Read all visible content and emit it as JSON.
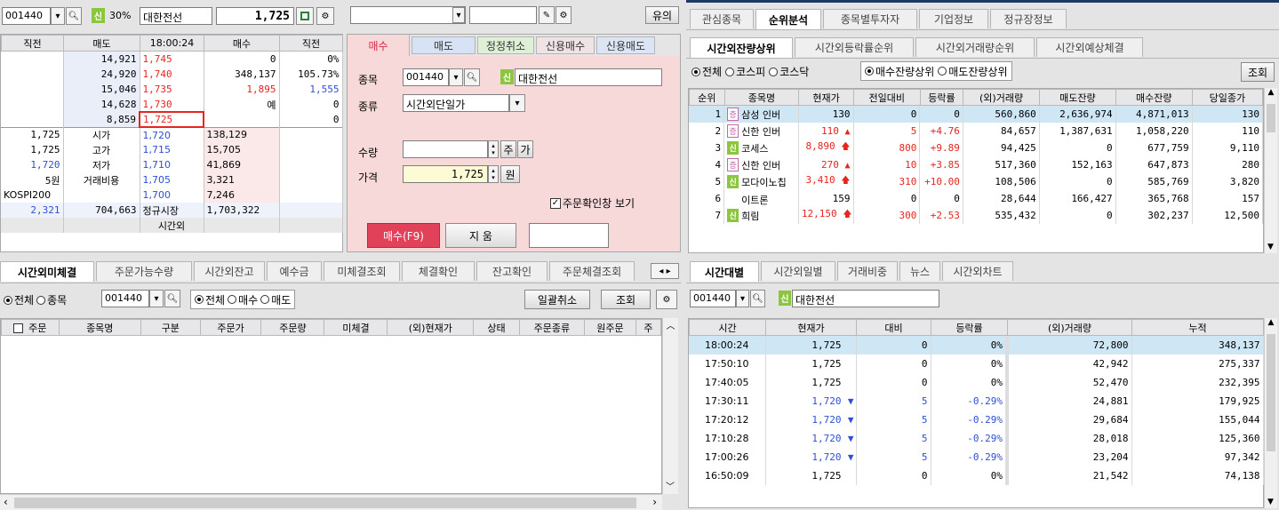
{
  "quote": {
    "code": "001440",
    "sin": "신",
    "ratio": "30%",
    "name": "대한전선",
    "price": "1,725",
    "warn_btn": "유의"
  },
  "orderbook": {
    "headers": [
      "직전",
      "매도",
      "18:00:24",
      "매수",
      "직전"
    ],
    "asks": [
      {
        "qty": "14,921",
        "price": "1,745",
        "pct": "0%"
      },
      {
        "qty": "24,920",
        "price": "1,740",
        "pct": "105.73%"
      },
      {
        "qty": "15,046",
        "price": "1,735",
        "pct": ""
      },
      {
        "qty": "14,628",
        "price": "1,730",
        "pct": ""
      },
      {
        "qty": "8,859",
        "price": "1,725",
        "pct": "0%"
      }
    ],
    "ask_side_extra": [
      {
        "a": "0",
        "b": ""
      },
      {
        "a": "348,137",
        "b": ""
      },
      {
        "a": "1,895",
        "b": "1,555"
      },
      {
        "a": "예",
        "b": "0"
      },
      {
        "a": "",
        "b": "0"
      }
    ],
    "bids": [
      {
        "label_v": "1,725",
        "label": "시가",
        "price": "1,720",
        "qty": "138,129"
      },
      {
        "label_v": "1,725",
        "label": "고가",
        "price": "1,715",
        "qty": "15,705"
      },
      {
        "label_v": "1,720",
        "label": "저가",
        "price": "1,710",
        "qty": "41,869"
      },
      {
        "label_v": "5원",
        "label": "거래비용",
        "price": "1,705",
        "qty": "3,321"
      },
      {
        "label_v": "KOSPI200",
        "label": "",
        "price": "1,700",
        "qty": "7,246"
      }
    ],
    "total": {
      "left": "2,321",
      "ask_total": "704,663",
      "mid": "정규시장",
      "bid_total": "1,703,322"
    },
    "footer": "시간외"
  },
  "order_panel": {
    "tabs": [
      "매수",
      "매도",
      "정정취소",
      "신용매수",
      "신용매도"
    ],
    "code_label": "종목",
    "code": "001440",
    "sin": "신",
    "name": "대한전선",
    "type_label": "종류",
    "type_value": "시간외단일가",
    "qty_label": "수량",
    "qty_btn1": "주",
    "qty_btn2": "가",
    "price_label": "가격",
    "price_value": "1,725",
    "price_unit": "원",
    "confirm_check": "주문확인창 보기",
    "buy_button": "매수(F9)",
    "clear_button": "지 움"
  },
  "ranking": {
    "top_tabs": [
      "관심종목",
      "순위분석",
      "종목별투자자",
      "기업정보",
      "정규장정보"
    ],
    "sub_tabs": [
      "시간외잔량상위",
      "시간외등락률순위",
      "시간외거래량순위",
      "시간외예상체결"
    ],
    "filters": [
      "전체",
      "코스피",
      "코스닥"
    ],
    "modes": [
      "매수잔량상위",
      "매도잔량상위"
    ],
    "query_button": "조회",
    "columns": [
      "순위",
      "종목명",
      "현재가",
      "전일대비",
      "등락률",
      "(외)거래량",
      "매도잔량",
      "매수잔량",
      "당일종가"
    ],
    "rows": [
      {
        "rank": "1",
        "badge": "jeung",
        "name": "삼성 인버",
        "price": "130",
        "chg": "0",
        "arrow": "",
        "rate": "0",
        "vol": "560,860",
        "ask": "2,636,974",
        "bid": "4,871,013",
        "close": "130",
        "color": ""
      },
      {
        "rank": "2",
        "badge": "jeung",
        "name": "신한 인버",
        "price": "110",
        "chg": "5",
        "arrow": "▲",
        "rate": "+4.76",
        "vol": "84,657",
        "ask": "1,387,631",
        "bid": "1,058,220",
        "close": "110",
        "color": "red"
      },
      {
        "rank": "3",
        "badge": "sin",
        "name": "코세스",
        "price": "8,890",
        "chg": "800",
        "arrow": "🡅",
        "rate": "+9.89",
        "vol": "94,425",
        "ask": "0",
        "bid": "677,759",
        "close": "9,110",
        "color": "red"
      },
      {
        "rank": "4",
        "badge": "jeung",
        "name": "신한 인버",
        "price": "270",
        "chg": "10",
        "arrow": "▲",
        "rate": "+3.85",
        "vol": "517,360",
        "ask": "152,163",
        "bid": "647,873",
        "close": "280",
        "color": "red"
      },
      {
        "rank": "5",
        "badge": "sin",
        "name": "모다이노칩",
        "price": "3,410",
        "chg": "310",
        "arrow": "🡅",
        "rate": "+10.00",
        "vol": "108,506",
        "ask": "0",
        "bid": "585,769",
        "close": "3,820",
        "color": "red"
      },
      {
        "rank": "6",
        "badge": "",
        "name": "이트론",
        "price": "159",
        "chg": "0",
        "arrow": "",
        "rate": "0",
        "vol": "28,644",
        "ask": "166,427",
        "bid": "365,768",
        "close": "157",
        "color": ""
      },
      {
        "rank": "7",
        "badge": "sin",
        "name": "희림",
        "price": "12,150",
        "chg": "300",
        "arrow": "🡅",
        "rate": "+2.53",
        "vol": "535,432",
        "ask": "0",
        "bid": "302,237",
        "close": "12,500",
        "color": "red"
      }
    ]
  },
  "unfilled": {
    "tabs": [
      "시간외미체결",
      "주문가능수량",
      "시간외잔고",
      "예수금",
      "미체결조회",
      "체결확인",
      "잔고확인",
      "주문체결조회"
    ],
    "filters": [
      "전체",
      "종목"
    ],
    "code": "001440",
    "sides": [
      "전체",
      "매수",
      "매도"
    ],
    "cancel_all": "일괄취소",
    "query": "조회",
    "columns": [
      "주문",
      "종목명",
      "구분",
      "주문가",
      "주문량",
      "미체결",
      "(외)현재가",
      "상태",
      "주문종류",
      "원주문",
      "주"
    ]
  },
  "timeline": {
    "tabs": [
      "시간대별",
      "시간외일별",
      "거래비중",
      "뉴스",
      "시간외차트"
    ],
    "code": "001440",
    "sin": "신",
    "name": "대한전선",
    "columns": [
      "시간",
      "현재가",
      "대비",
      "등락률",
      "(외)거래량",
      "누적"
    ],
    "rows": [
      {
        "time": "18:00:24",
        "price": "1,725",
        "arrow": "",
        "chg": "0",
        "rate": "0%",
        "vol": "72,800",
        "cum": "348,137",
        "color": ""
      },
      {
        "time": "17:50:10",
        "price": "1,725",
        "arrow": "",
        "chg": "0",
        "rate": "0%",
        "vol": "42,942",
        "cum": "275,337",
        "color": ""
      },
      {
        "time": "17:40:05",
        "price": "1,725",
        "arrow": "",
        "chg": "0",
        "rate": "0%",
        "vol": "52,470",
        "cum": "232,395",
        "color": ""
      },
      {
        "time": "17:30:11",
        "price": "1,720",
        "arrow": "▼",
        "chg": "5",
        "rate": "-0.29%",
        "vol": "24,881",
        "cum": "179,925",
        "color": "blue"
      },
      {
        "time": "17:20:12",
        "price": "1,720",
        "arrow": "▼",
        "chg": "5",
        "rate": "-0.29%",
        "vol": "29,684",
        "cum": "155,044",
        "color": "blue"
      },
      {
        "time": "17:10:28",
        "price": "1,720",
        "arrow": "▼",
        "chg": "5",
        "rate": "-0.29%",
        "vol": "28,018",
        "cum": "125,360",
        "color": "blue"
      },
      {
        "time": "17:00:26",
        "price": "1,720",
        "arrow": "▼",
        "chg": "5",
        "rate": "-0.29%",
        "vol": "23,204",
        "cum": "97,342",
        "color": "blue"
      },
      {
        "time": "16:50:09",
        "price": "1,725",
        "arrow": "",
        "chg": "0",
        "rate": "0%",
        "vol": "21,542",
        "cum": "74,138",
        "color": ""
      }
    ]
  },
  "colors": {
    "up": "#e8241f",
    "down": "#2e4fd6",
    "buy_btn": "#e2415a",
    "ask_bg": "#e9eef9",
    "bid_bg": "#fbe9ea",
    "order_bg": "#f7d9d9",
    "select_row": "#cfe6f5"
  }
}
